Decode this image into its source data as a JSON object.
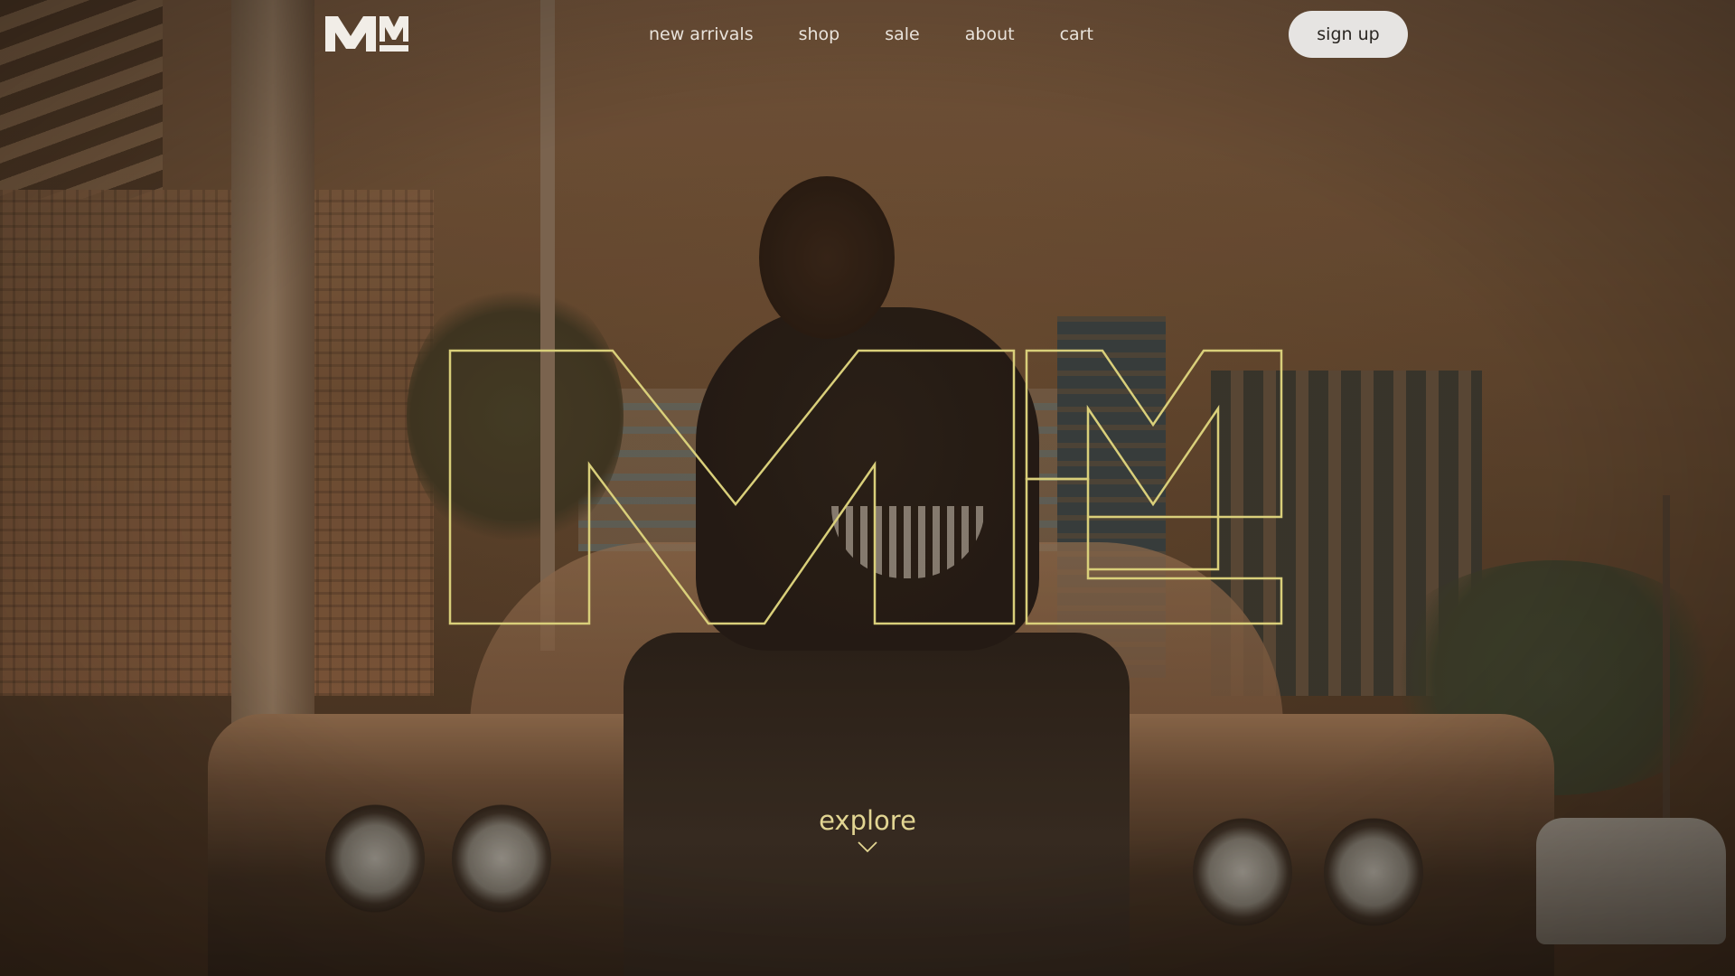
{
  "brand": {
    "logo_text": "MM",
    "accent_color": "#e2d592",
    "outline_color": "#d9cf7a"
  },
  "nav": {
    "items": [
      {
        "label": "new arrivals"
      },
      {
        "label": "shop"
      },
      {
        "label": "sale"
      },
      {
        "label": "about"
      },
      {
        "label": "cart"
      }
    ],
    "signup_label": "sign up"
  },
  "hero": {
    "big_mark": "MM",
    "cta_label": "explore",
    "cta_icon": "chevron-down-icon"
  }
}
